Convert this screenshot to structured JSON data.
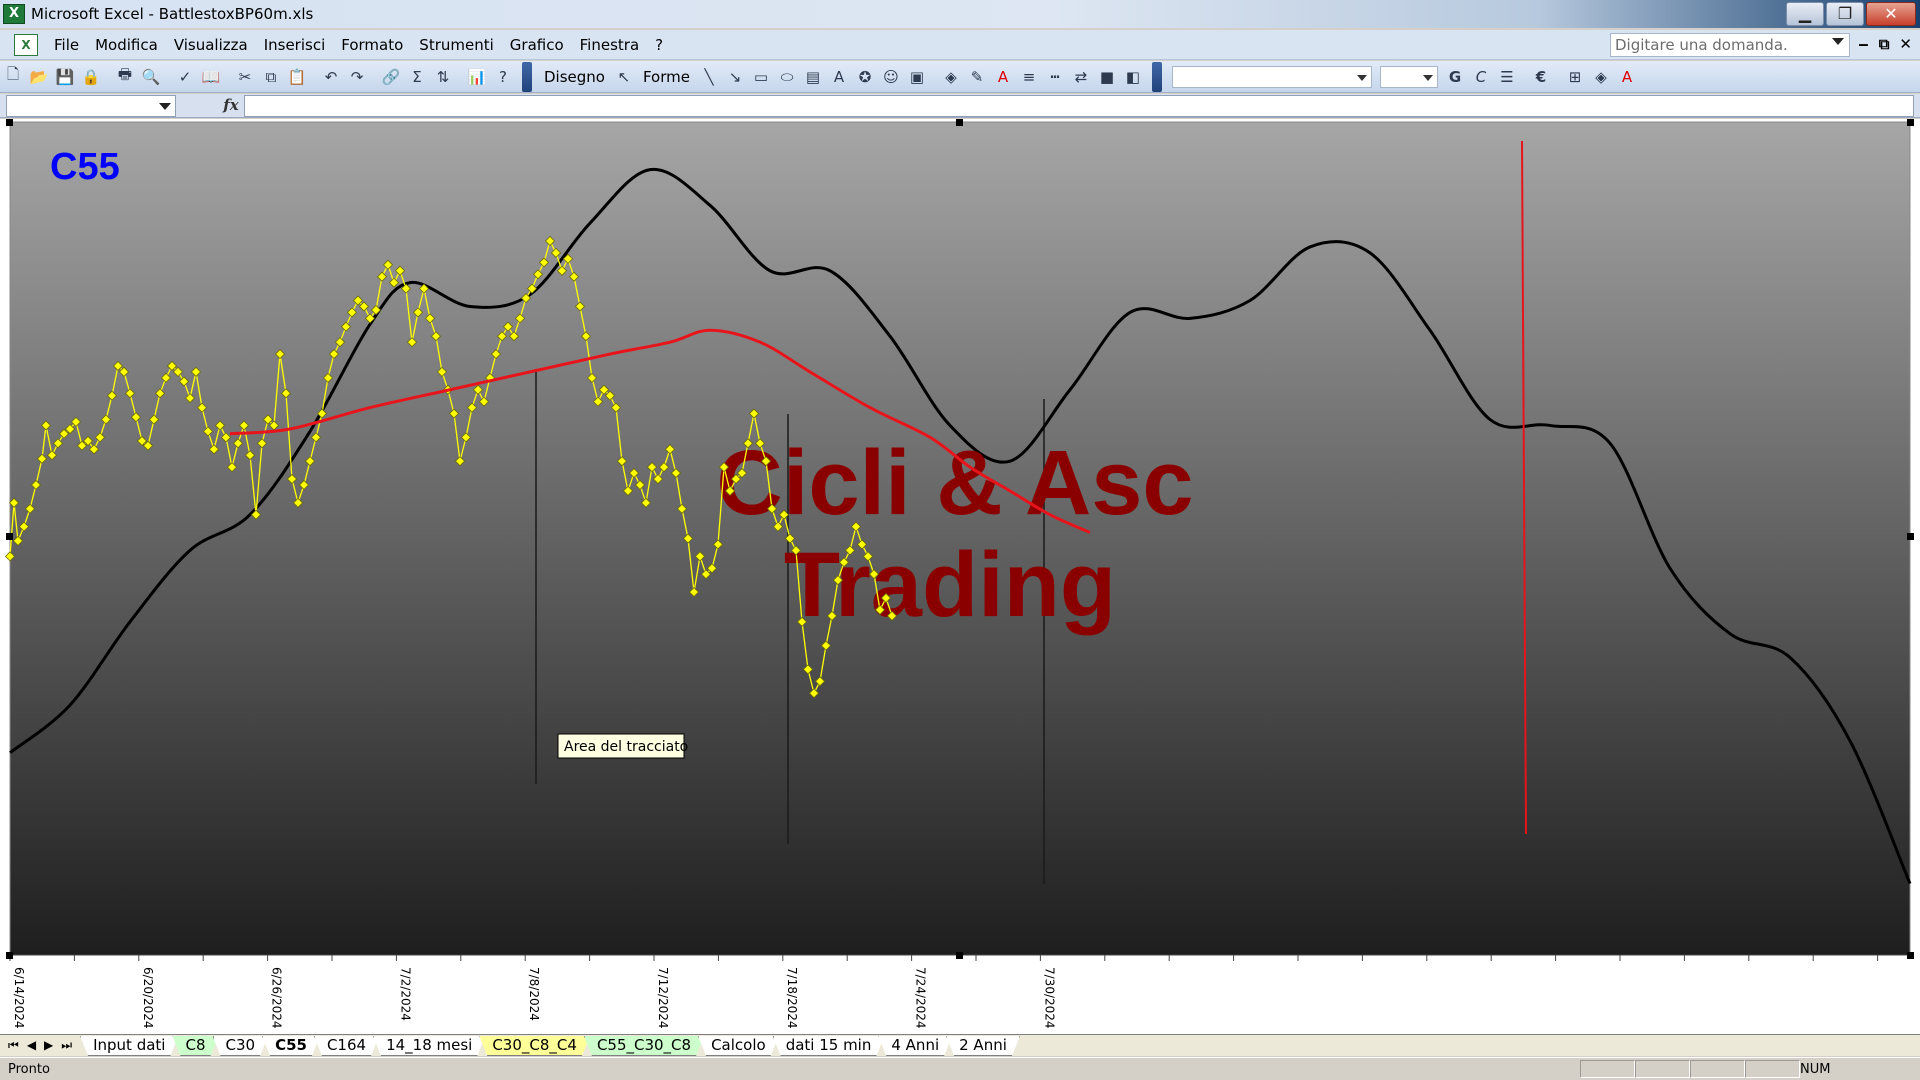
{
  "window": {
    "title": "Microsoft Excel - BattlestoxBP60m.xls",
    "app_icon": "excel-icon",
    "minimize_glyph": "▁",
    "maximize_glyph": "❐",
    "close_glyph": "✕"
  },
  "menubar": {
    "items": [
      "File",
      "Modifica",
      "Visualizza",
      "Inserisci",
      "Formato",
      "Strumenti",
      "Grafico",
      "Finestra",
      "?"
    ],
    "ask_placeholder": "Digitare una domanda.",
    "doc_glyphs": [
      "‒",
      "⧉",
      "✕"
    ]
  },
  "toolbar": {
    "drawing_label": "Disegno",
    "shapes_label": "Forme",
    "bold_label": "G",
    "italic_label": "C",
    "currency_label": "€",
    "sum_label": "Σ",
    "font_color_label": "A"
  },
  "formula": {
    "fx_label": "fx"
  },
  "chart": {
    "chart_label": "C55",
    "watermark_line1": "Cicli & Asc",
    "watermark_line2": "Trading",
    "tooltip": "Area del tracciato",
    "colors": {
      "price": "#ffff00",
      "price_marker_stroke": "#6a6a00",
      "moving_average": "#e8141b",
      "cycle": "#000000",
      "label": "#0000ff",
      "watermark": "#8a0000",
      "bg_top": "#a6a6a6",
      "bg_bottom": "#1e1e1e"
    }
  },
  "chart_data": {
    "type": "line",
    "x_ticks": [
      "6/14/2024",
      "6/20/2024",
      "6/26/2024",
      "7/2/2024",
      "7/8/2024",
      "7/12/2024",
      "7/18/2024",
      "7/24/2024",
      "7/30/2024"
    ],
    "series": [
      {
        "type": "line-with-markers",
        "points": [
          [
            0,
            365
          ],
          [
            2,
            320
          ],
          [
            4,
            352
          ],
          [
            7,
            340
          ],
          [
            10,
            325
          ],
          [
            13,
            305
          ],
          [
            16,
            283
          ],
          [
            18,
            255
          ],
          [
            21,
            280
          ],
          [
            24,
            270
          ],
          [
            27,
            262
          ],
          [
            30,
            258
          ],
          [
            33,
            252
          ],
          [
            36,
            272
          ],
          [
            39,
            268
          ],
          [
            42,
            275
          ],
          [
            45,
            265
          ],
          [
            48,
            250
          ],
          [
            51,
            230
          ],
          [
            54,
            205
          ],
          [
            57,
            210
          ],
          [
            60,
            228
          ],
          [
            63,
            248
          ],
          [
            66,
            268
          ],
          [
            69,
            272
          ],
          [
            72,
            250
          ],
          [
            75,
            228
          ],
          [
            78,
            215
          ],
          [
            81,
            205
          ],
          [
            84,
            210
          ],
          [
            87,
            218
          ],
          [
            90,
            232
          ],
          [
            93,
            210
          ],
          [
            96,
            240
          ],
          [
            99,
            260
          ],
          [
            102,
            275
          ],
          [
            105,
            255
          ],
          [
            108,
            265
          ],
          [
            111,
            290
          ],
          [
            114,
            270
          ],
          [
            117,
            255
          ],
          [
            120,
            280
          ],
          [
            123,
            330
          ],
          [
            126,
            270
          ],
          [
            129,
            250
          ],
          [
            132,
            255
          ],
          [
            135,
            195
          ],
          [
            138,
            228
          ],
          [
            141,
            300
          ],
          [
            144,
            320
          ],
          [
            147,
            305
          ],
          [
            150,
            285
          ],
          [
            153,
            265
          ],
          [
            156,
            245
          ],
          [
            159,
            215
          ],
          [
            162,
            195
          ],
          [
            165,
            185
          ],
          [
            168,
            172
          ],
          [
            171,
            160
          ],
          [
            174,
            150
          ],
          [
            177,
            155
          ],
          [
            180,
            165
          ],
          [
            183,
            158
          ],
          [
            186,
            130
          ],
          [
            189,
            120
          ],
          [
            192,
            135
          ],
          [
            195,
            125
          ],
          [
            198,
            140
          ],
          [
            201,
            185
          ],
          [
            204,
            160
          ],
          [
            207,
            140
          ],
          [
            210,
            165
          ],
          [
            213,
            180
          ],
          [
            216,
            210
          ],
          [
            219,
            225
          ],
          [
            222,
            245
          ],
          [
            225,
            285
          ],
          [
            228,
            265
          ],
          [
            231,
            240
          ],
          [
            234,
            225
          ],
          [
            237,
            235
          ],
          [
            240,
            215
          ],
          [
            243,
            195
          ],
          [
            246,
            180
          ],
          [
            249,
            172
          ],
          [
            252,
            180
          ],
          [
            255,
            165
          ],
          [
            258,
            148
          ],
          [
            261,
            140
          ],
          [
            264,
            128
          ],
          [
            267,
            118
          ],
          [
            270,
            100
          ],
          [
            273,
            110
          ],
          [
            276,
            125
          ],
          [
            279,
            115
          ],
          [
            282,
            130
          ],
          [
            285,
            155
          ],
          [
            288,
            180
          ],
          [
            291,
            215
          ],
          [
            294,
            235
          ],
          [
            297,
            225
          ],
          [
            300,
            230
          ],
          [
            303,
            240
          ],
          [
            306,
            285
          ],
          [
            309,
            310
          ],
          [
            312,
            295
          ],
          [
            315,
            305
          ],
          [
            318,
            320
          ],
          [
            321,
            290
          ],
          [
            324,
            300
          ],
          [
            327,
            290
          ],
          [
            330,
            275
          ],
          [
            333,
            295
          ],
          [
            336,
            325
          ],
          [
            339,
            350
          ],
          [
            342,
            395
          ],
          [
            345,
            365
          ],
          [
            348,
            380
          ],
          [
            351,
            375
          ],
          [
            354,
            355
          ],
          [
            357,
            290
          ],
          [
            360,
            310
          ],
          [
            363,
            300
          ],
          [
            366,
            295
          ],
          [
            369,
            270
          ],
          [
            372,
            245
          ],
          [
            375,
            270
          ],
          [
            378,
            285
          ],
          [
            381,
            325
          ],
          [
            384,
            340
          ],
          [
            387,
            330
          ],
          [
            390,
            350
          ],
          [
            393,
            360
          ],
          [
            396,
            420
          ],
          [
            399,
            460
          ],
          [
            402,
            480
          ],
          [
            405,
            470
          ],
          [
            408,
            440
          ],
          [
            411,
            415
          ],
          [
            414,
            385
          ],
          [
            417,
            370
          ],
          [
            420,
            360
          ],
          [
            423,
            340
          ],
          [
            426,
            355
          ],
          [
            429,
            365
          ],
          [
            432,
            380
          ],
          [
            435,
            410
          ],
          [
            438,
            400
          ],
          [
            441,
            415
          ]
        ],
        "description_axis_note": "x = bar index (~2 bars per data tick-day), y = chart value units (0 top .. 700 bottom of plot)"
      },
      {
        "type": "moving-average",
        "points": [
          [
            110,
            262
          ],
          [
            140,
            258
          ],
          [
            180,
            240
          ],
          [
            220,
            225
          ],
          [
            260,
            210
          ],
          [
            300,
            195
          ],
          [
            330,
            185
          ],
          [
            350,
            175
          ],
          [
            375,
            185
          ],
          [
            400,
            210
          ],
          [
            430,
            240
          ],
          [
            460,
            265
          ],
          [
            480,
            290
          ],
          [
            500,
            310
          ],
          [
            520,
            330
          ],
          [
            540,
            345
          ]
        ]
      },
      {
        "type": "cycle",
        "points": [
          [
            0,
            530
          ],
          [
            30,
            490
          ],
          [
            60,
            420
          ],
          [
            90,
            360
          ],
          [
            120,
            330
          ],
          [
            150,
            260
          ],
          [
            180,
            170
          ],
          [
            200,
            135
          ],
          [
            230,
            155
          ],
          [
            260,
            145
          ],
          [
            290,
            85
          ],
          [
            320,
            40
          ],
          [
            350,
            70
          ],
          [
            380,
            125
          ],
          [
            410,
            125
          ],
          [
            440,
            180
          ],
          [
            470,
            255
          ],
          [
            500,
            285
          ],
          [
            530,
            225
          ],
          [
            560,
            160
          ],
          [
            590,
            165
          ],
          [
            620,
            150
          ],
          [
            650,
            105
          ],
          [
            680,
            110
          ],
          [
            710,
            175
          ],
          [
            740,
            250
          ],
          [
            770,
            255
          ],
          [
            800,
            270
          ],
          [
            830,
            375
          ],
          [
            860,
            430
          ],
          [
            890,
            450
          ],
          [
            920,
            520
          ],
          [
            950,
            640
          ]
        ]
      }
    ],
    "vertical_lines": [
      263,
      389,
      517
    ],
    "red_marker_x": 756
  },
  "sheet_tabs": [
    {
      "label": "Input dati",
      "color": "white"
    },
    {
      "label": "C8",
      "color": "green"
    },
    {
      "label": "C30",
      "color": "white"
    },
    {
      "label": "C55",
      "color": "active"
    },
    {
      "label": "C164",
      "color": "white"
    },
    {
      "label": "14_18 mesi",
      "color": "white"
    },
    {
      "label": "C30_C8_C4",
      "color": "yellow"
    },
    {
      "label": "C55_C30_C8",
      "color": "green"
    },
    {
      "label": "Calcolo",
      "color": "white"
    },
    {
      "label": "dati 15 min",
      "color": "white"
    },
    {
      "label": "4 Anni",
      "color": "white"
    },
    {
      "label": "2 Anni",
      "color": "white"
    }
  ],
  "tab_nav": [
    "⏮",
    "◀",
    "▶",
    "⏭"
  ],
  "status": {
    "ready": "Pronto",
    "num": "NUM"
  }
}
